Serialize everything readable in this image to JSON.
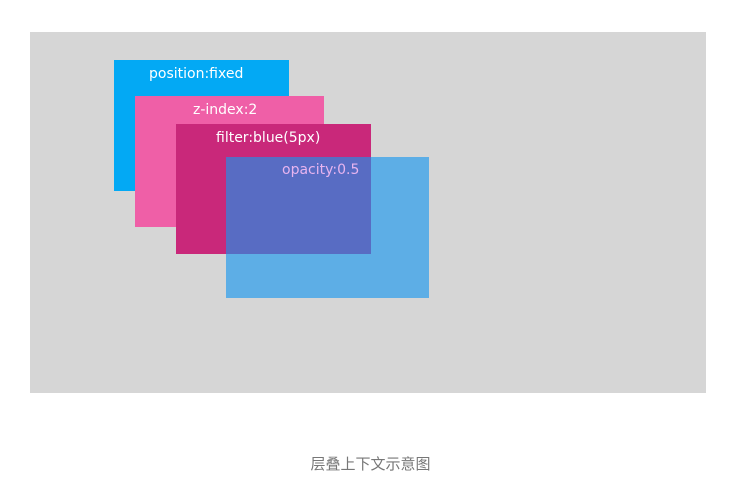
{
  "diagram": {
    "layers": {
      "fixed": {
        "label": "position:fixed",
        "color": "#03a9f4"
      },
      "zindex": {
        "label": "z-index:2",
        "color": "#ef5fa7"
      },
      "filter": {
        "label": "filter:blue(5px)",
        "color": "#c9287a"
      },
      "opacity": {
        "label": "opacity:0.5",
        "color": "#5bb7ee"
      }
    },
    "background_color": "#d6d6d6"
  },
  "caption": "层叠上下文示意图"
}
